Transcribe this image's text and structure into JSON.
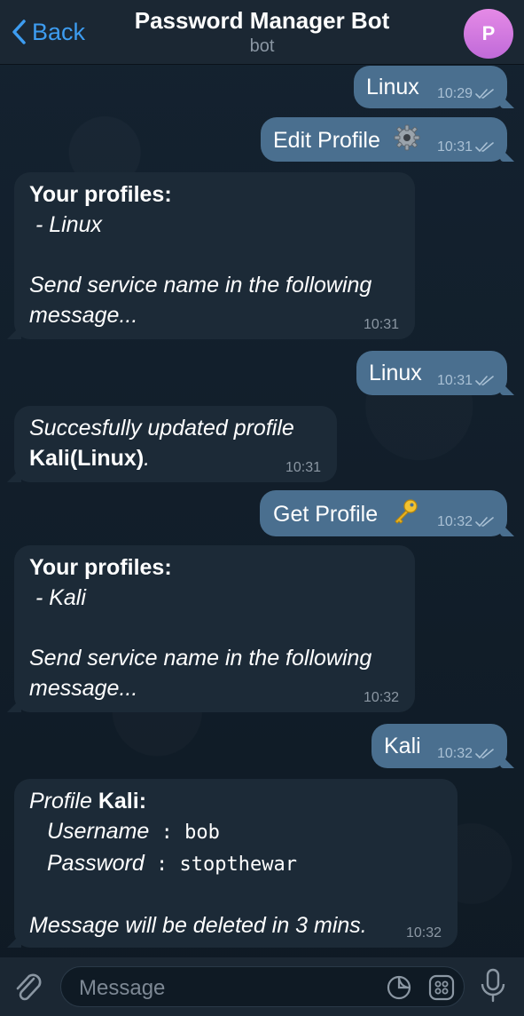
{
  "header": {
    "back_label": "Back",
    "title": "Password Manager Bot",
    "subtitle": "bot",
    "avatar_initial": "P",
    "avatar_color": "#d37ade"
  },
  "messages": [
    {
      "from": "me",
      "text": "Linux",
      "time": "10:29",
      "status": "read"
    },
    {
      "from": "me",
      "text": "Edit Profile",
      "emoji": "gear-icon",
      "time": "10:31",
      "status": "read"
    },
    {
      "from": "bot",
      "title": "Your profiles:",
      "item": " - Linux",
      "note1": "Send service name in the following",
      "note2": "message...",
      "time": "10:31"
    },
    {
      "from": "me",
      "text": "Linux",
      "time": "10:31",
      "status": "read"
    },
    {
      "from": "bot",
      "line1": "Succesfully updated profile",
      "bold": "Kali(Linux)",
      "after": ".",
      "time": "10:31"
    },
    {
      "from": "me",
      "text": "Get Profile",
      "emoji": "key-icon",
      "time": "10:32",
      "status": "read"
    },
    {
      "from": "bot",
      "title": "Your profiles:",
      "item": " - Kali",
      "note1": "Send service name in the following",
      "note2": "message...",
      "time": "10:32"
    },
    {
      "from": "me",
      "text": "Kali",
      "time": "10:32",
      "status": "read"
    },
    {
      "from": "bot",
      "profile_label": "Profile",
      "profile_name": "Kali",
      "colon": ":",
      "username_label": "Username",
      "username_value": "bob",
      "password_label": "Password",
      "password_value": "stopthewar",
      "sep": " : ",
      "footer": "Message will be deleted in 3 mins.",
      "time": "10:32"
    }
  ],
  "input": {
    "placeholder": "Message"
  },
  "colors": {
    "accent": "#3d9cf0",
    "outgoing_bubble": "#4a6f8f",
    "incoming_bubble": "#1c2a37"
  }
}
